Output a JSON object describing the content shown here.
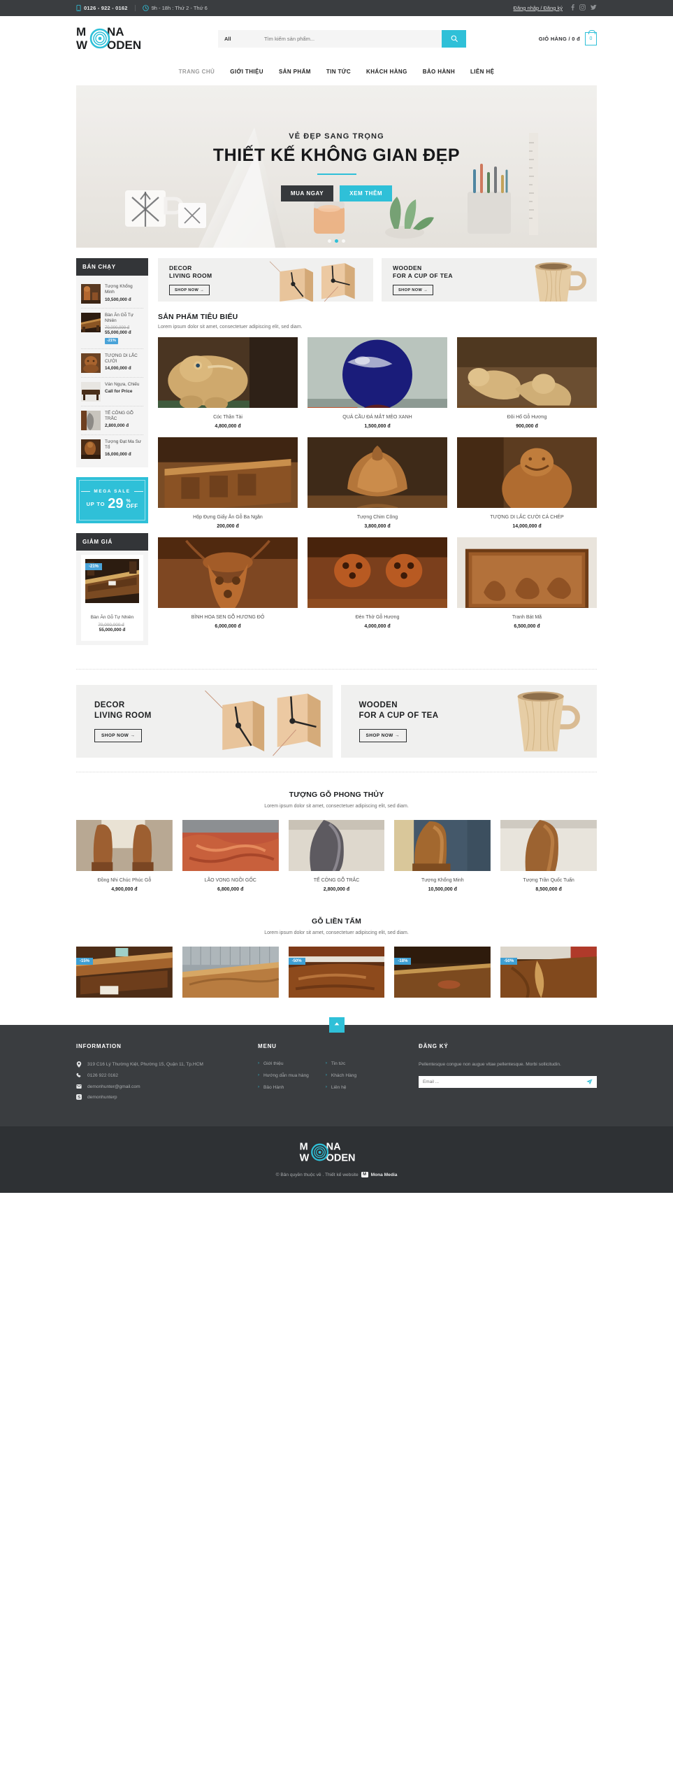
{
  "topbar": {
    "phone": "0126 - 922 - 0162",
    "hours": "9h - 18h : Thứ 2 - Thứ 6",
    "auth": "Đăng nhập / Đăng ký",
    "social": [
      "facebook-icon",
      "instagram-icon",
      "twitter-icon"
    ]
  },
  "header": {
    "logo_line1": "M  NA",
    "logo_line2": "W  ODEN",
    "search_category": "All",
    "search_placeholder": "Tìm kiếm sản phẩm...",
    "search_value": "",
    "search_icon": "search-icon",
    "cart_label": "GIỎ HÀNG / 0 đ",
    "cart_count": "0"
  },
  "nav": [
    {
      "label": "TRANG CHỦ",
      "active": true
    },
    {
      "label": "GIỚI THIỆU",
      "active": false
    },
    {
      "label": "SẢN PHẨM",
      "active": false
    },
    {
      "label": "TIN TỨC",
      "active": false
    },
    {
      "label": "KHÁCH HÀNG",
      "active": false
    },
    {
      "label": "BẢO HÀNH",
      "active": false
    },
    {
      "label": "LIÊN HỆ",
      "active": false
    }
  ],
  "hero": {
    "subtitle": "VẺ ĐẸP SANG TRỌNG",
    "title": "THIẾT KẾ KHÔNG GIAN ĐẸP",
    "btn_primary": "MUA NGAY",
    "btn_secondary": "XEM THÊM",
    "dots": 3,
    "active_dot": 1
  },
  "sidebar": {
    "bestseller_title": "BÁN CHẠY",
    "bestsellers": [
      {
        "name": "Tượng Khổng Minh",
        "price": "10,500,000 đ",
        "old_price": "",
        "badge": ""
      },
      {
        "name": "Bàn Ăn Gỗ Tự Nhiên",
        "price": "55,000,000 đ",
        "old_price": "70,000,000 đ",
        "badge": "-21%"
      },
      {
        "name": "TƯỢNG DI LẮC CƯỜI",
        "price": "14,000,000 đ",
        "old_price": "",
        "badge": ""
      },
      {
        "name": "Ván Ngựa, Chiếu",
        "price": "Call for Price",
        "old_price": "",
        "badge": ""
      },
      {
        "name": "TẾ CÔNG GỖ TRẮC",
        "price": "2,800,000 đ",
        "old_price": "",
        "badge": ""
      },
      {
        "name": "Tượng Đạt Ma Sư Tổ",
        "price": "16,000,000 đ",
        "old_price": "",
        "badge": ""
      }
    ],
    "megasale": {
      "label": "MEGA SALE",
      "upto": "UP TO",
      "number": "29",
      "percent": "%",
      "off": "OFF"
    },
    "discount_title": "GIẢM GIÁ",
    "discount_product": {
      "name": "Bàn Ăn Gỗ Tự Nhiên",
      "old_price": "70,000,000 đ",
      "price": "55,000,000 đ",
      "badge": "-21%"
    }
  },
  "promos_top": [
    {
      "line1": "DECOR",
      "line2": "LIVING ROOM",
      "btn": "SHOP NOW →",
      "art": "clock"
    },
    {
      "line1": "WOODEN",
      "line2": "FOR A CUP OF TEA",
      "btn": "SHOP NOW →",
      "art": "cup"
    }
  ],
  "promos_bottom": [
    {
      "line1": "DECOR",
      "line2": "LIVING ROOM",
      "btn": "SHOP NOW →",
      "art": "clock"
    },
    {
      "line1": "WOODEN",
      "line2": "FOR A CUP OF TEA",
      "btn": "SHOP NOW →",
      "art": "cup"
    }
  ],
  "featured": {
    "title": "SẢN PHẨM TIÊU BIỂU",
    "desc": "Lorem ipsum dolor sit amet, consectetuer adipiscing elit, sed diam.",
    "products": [
      {
        "name": "Cóc Thần Tài",
        "price": "4,800,000 đ",
        "badge": ""
      },
      {
        "name": "QUẢ CẦU ĐÁ MẮT MÈO XANH",
        "price": "1,500,000 đ",
        "badge": ""
      },
      {
        "name": "Đôi Hổ Gỗ Hương",
        "price": "900,000 đ",
        "badge": ""
      },
      {
        "name": "Hộp Đựng Giấy Ăn Gỗ Ba Ngăn",
        "price": "200,000 đ",
        "badge": ""
      },
      {
        "name": "Tượng Chim Công",
        "price": "3,800,000 đ",
        "badge": ""
      },
      {
        "name": "TƯỢNG DI LẮC CƯỜI CÁ CHÉP",
        "price": "14,000,000 đ",
        "badge": ""
      },
      {
        "name": "BÌNH HOA SEN GỖ HƯƠNG ĐỎ",
        "price": "6,000,000 đ",
        "badge": ""
      },
      {
        "name": "Đèn Thờ Gỗ Hương",
        "price": "4,000,000 đ",
        "badge": ""
      },
      {
        "name": "Tranh Bát Mã",
        "price": "6,500,000 đ",
        "badge": ""
      }
    ]
  },
  "phongthuy": {
    "title": "TƯỢNG GỖ PHONG THỦY",
    "desc": "Lorem ipsum dolor sit amet, consectetuer adipiscing elit, sed diam.",
    "products": [
      {
        "name": "Đồng Nhi Chúc Phúc Gỗ",
        "price": "4,900,000 đ",
        "badge": ""
      },
      {
        "name": "LÃO VONG NGỒI GỐC",
        "price": "6,800,000 đ",
        "badge": ""
      },
      {
        "name": "TẾ CÔNG GỖ TRẮC",
        "price": "2,800,000 đ",
        "badge": ""
      },
      {
        "name": "Tượng Khổng Minh",
        "price": "10,500,000 đ",
        "badge": ""
      },
      {
        "name": "Tượng Trần Quốc Tuấn",
        "price": "8,500,000 đ",
        "badge": ""
      }
    ]
  },
  "lientam": {
    "title": "GỖ LIỀN TẤM",
    "desc": "Lorem ipsum dolor sit amet, consectetuer adipiscing elit, sed diam.",
    "products": [
      {
        "name": "",
        "price": "",
        "badge": "-15%"
      },
      {
        "name": "",
        "price": "",
        "badge": ""
      },
      {
        "name": "",
        "price": "",
        "badge": "-50%"
      },
      {
        "name": "",
        "price": "",
        "badge": "-18%"
      },
      {
        "name": "",
        "price": "",
        "badge": "-50%"
      }
    ]
  },
  "footer": {
    "scroll_top_icon": "arrow-up-icon",
    "information": {
      "title": "INFORMATION",
      "address": "319 C16 Lý Thường Kiệt, Phường 15, Quận 11, Tp.HCM",
      "phone": "0126 922 0162",
      "email": "demonhunter@gmail.com",
      "skype": "demonhunterp"
    },
    "menu": {
      "title": "MENU",
      "col1": [
        "Giới thiệu",
        "Hướng dẫn mua hàng",
        "Bảo Hành"
      ],
      "col2": [
        "Tin tức",
        "Khách Hàng",
        "Liên hệ"
      ]
    },
    "subscribe": {
      "title": "ĐĂNG KÝ",
      "text": "Pellentesque congue non augue vitae pellentesque. Morbi sollicitudin.",
      "placeholder": "Email ...",
      "value": "",
      "send_icon": "send-icon"
    },
    "bottom": {
      "logo_line1": "M  NA",
      "logo_line2": "W  ODEN",
      "copyright_pre": "© Bản quyền thuộc về . Thiết kế website",
      "brand": "Mona Media"
    }
  },
  "colors": {
    "accent": "#2fc0d8",
    "dark": "#3a3d40",
    "darker": "#2e3134",
    "badge_blue": "#4aa3d8"
  }
}
